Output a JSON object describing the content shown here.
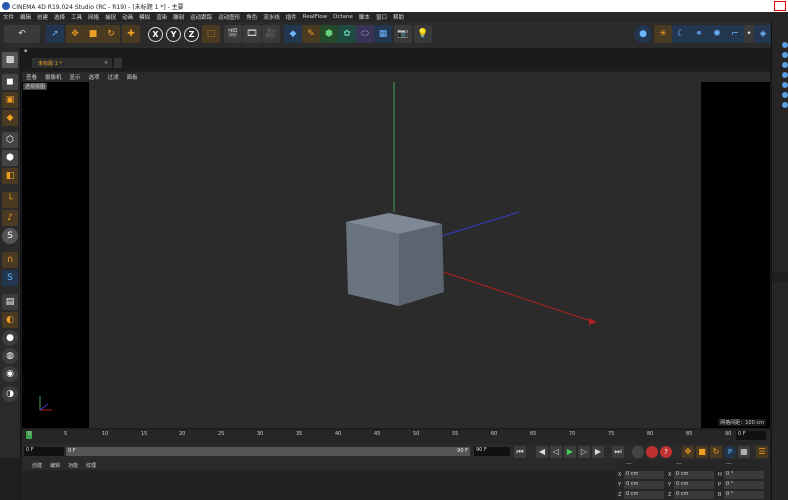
{
  "window": {
    "title": "CINEMA 4D R19.024 Studio (RC - R19) - [未标题 1 *] - 主要"
  },
  "menu": [
    "文件",
    "编辑",
    "创建",
    "选择",
    "工具",
    "网格",
    "捕捉",
    "动画",
    "模拟",
    "渲染",
    "雕刻",
    "运动跟踪",
    "运动图形",
    "角色",
    "流水线",
    "插件",
    "RealFlow",
    "Octane",
    "脚本",
    "窗口",
    "帮助"
  ],
  "tab": {
    "label": "未标题 1 *"
  },
  "viewport": {
    "menu": [
      "查看",
      "摄像机",
      "显示",
      "选项",
      "过滤",
      "面板"
    ],
    "label": "透视视图",
    "grid_label": "网格间距：100 cm"
  },
  "timeline": {
    "ticks": [
      "0",
      "5",
      "10",
      "15",
      "20",
      "25",
      "30",
      "35",
      "40",
      "45",
      "50",
      "55",
      "60",
      "65",
      "70",
      "75",
      "80",
      "85",
      "90"
    ],
    "current_frame": "0 F"
  },
  "timectrl": {
    "start_frame": "0 F",
    "slider_start": "0 F",
    "slider_end": "90 F",
    "end_frame": "90 F"
  },
  "bottompanel": {
    "tabs": [
      "创建",
      "编辑",
      "功能",
      "纹理"
    ]
  },
  "coords": {
    "header": [
      "---",
      "---",
      "---"
    ],
    "rows": [
      {
        "a": "X",
        "av": "0 cm",
        "b": "X",
        "bv": "0 cm",
        "c": "H",
        "cv": "0 °"
      },
      {
        "a": "Y",
        "av": "0 cm",
        "b": "Y",
        "bv": "0 cm",
        "c": "P",
        "cv": "0 °"
      },
      {
        "a": "Z",
        "av": "0 cm",
        "b": "Z",
        "bv": "0 cm",
        "c": "B",
        "cv": "0 °"
      }
    ]
  },
  "icons": {
    "undo": "undo-icon",
    "axis_x": "X",
    "axis_y": "Y",
    "axis_z": "Z"
  }
}
